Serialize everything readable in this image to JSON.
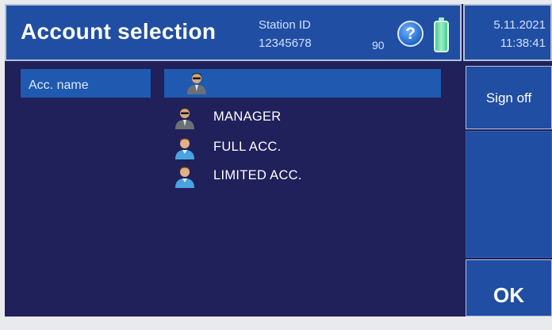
{
  "header": {
    "title": "Account selection",
    "station_label": "Station ID",
    "station_id": "12345678",
    "battery_level": "90",
    "help_symbol": "?",
    "help_icon": "help-icon",
    "battery_icon": "battery-icon"
  },
  "datetime": {
    "date": "5.11.2021",
    "time": "11:38:41"
  },
  "side_buttons": {
    "sign_off": "Sign off",
    "ok": "OK"
  },
  "account_field": {
    "label": "Acc. name",
    "value": "",
    "icon": "manager-user-icon"
  },
  "accounts": [
    {
      "label": "MANAGER",
      "icon": "manager-user-icon"
    },
    {
      "label": "FULL ACC.",
      "icon": "user-icon"
    },
    {
      "label": "LIMITED ACC.",
      "icon": "user-icon"
    }
  ],
  "colors": {
    "background": "#20205a",
    "panel_blue": "#204ea2",
    "field_blue": "#1f5ab0",
    "battery_green": "#4fc893"
  }
}
